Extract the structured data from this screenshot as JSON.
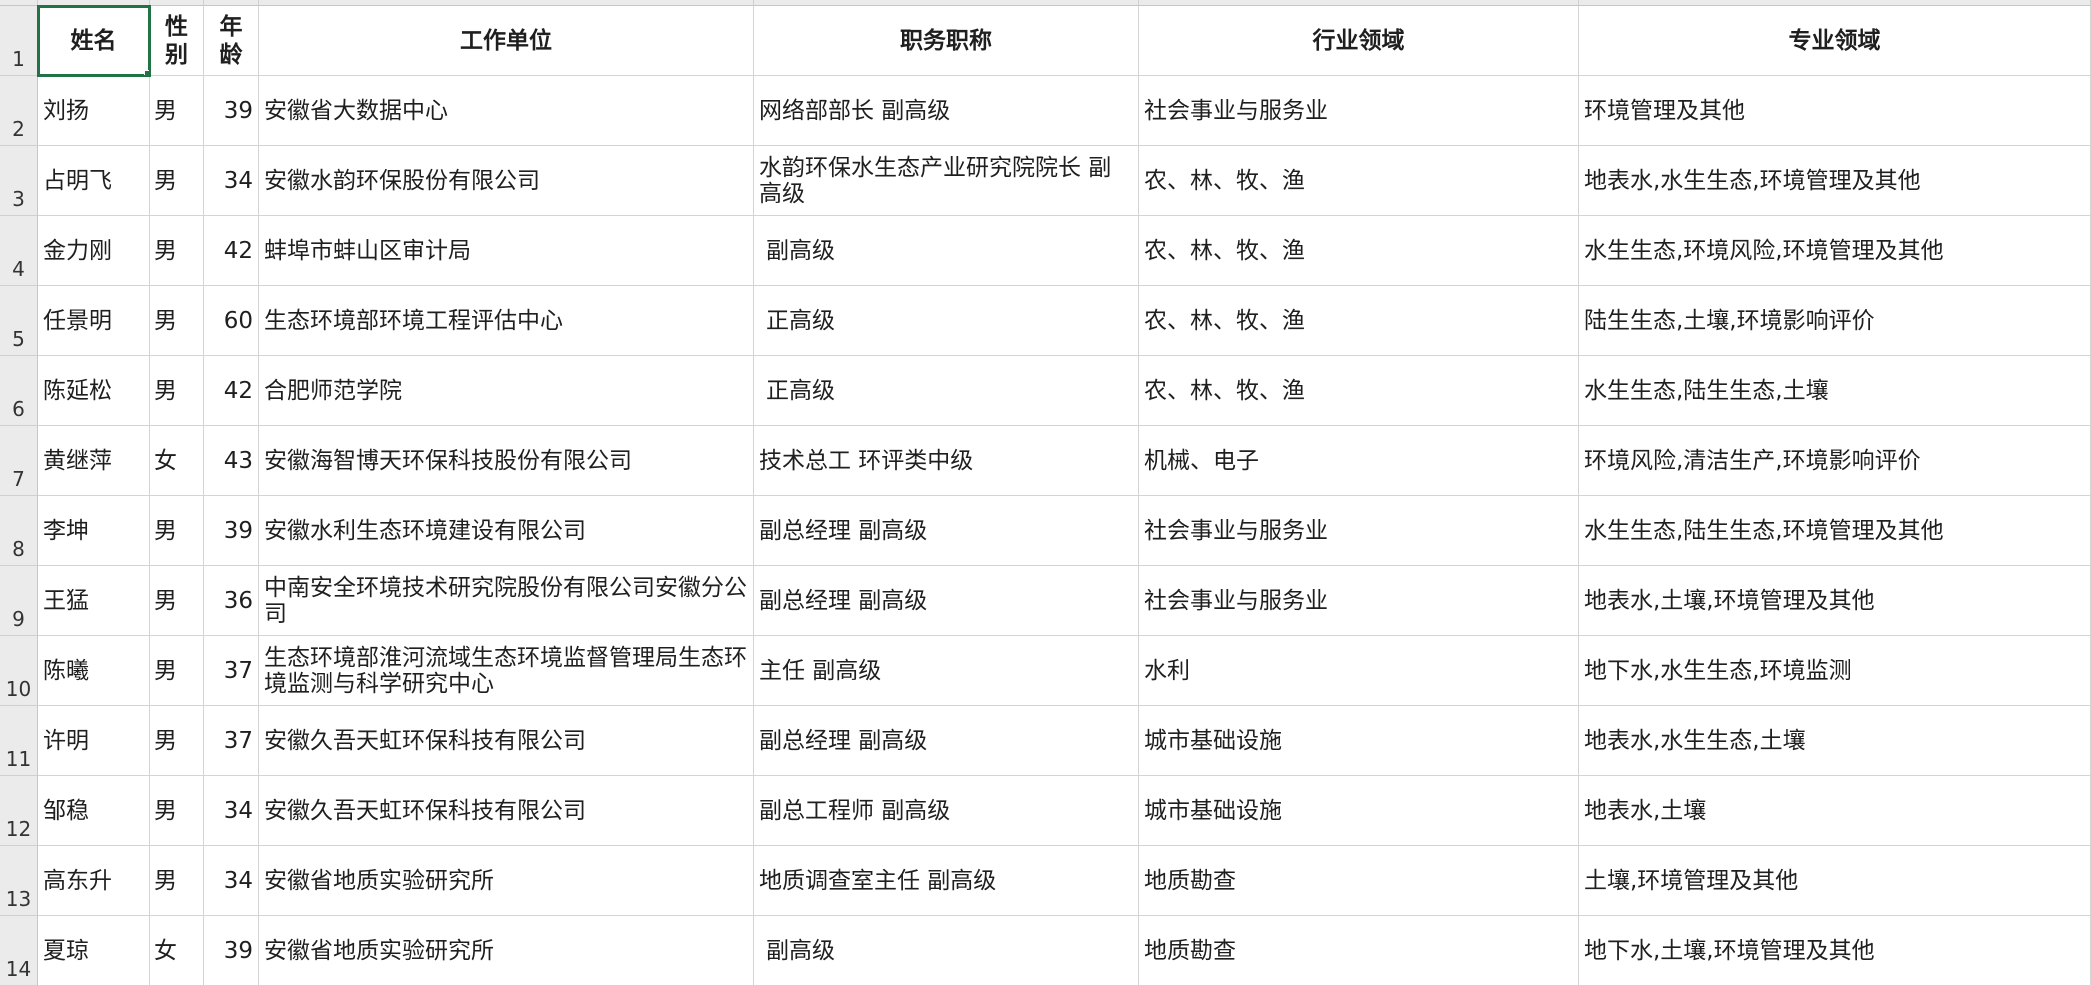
{
  "headers": [
    "姓名",
    "性别",
    "年龄",
    "工作单位",
    "职务职称",
    "行业领域",
    "专业领域"
  ],
  "row_numbers": [
    "1",
    "2",
    "3",
    "4",
    "5",
    "6",
    "7",
    "8",
    "9",
    "10",
    "11",
    "12",
    "13",
    "14"
  ],
  "rows": [
    [
      "刘扬",
      "男",
      "39",
      "安徽省大数据中心",
      "网络部部长 副高级",
      "社会事业与服务业",
      "环境管理及其他"
    ],
    [
      "占明飞",
      "男",
      "34",
      "安徽水韵环保股份有限公司",
      "水韵环保水生态产业研究院院长 副高级",
      "农、林、牧、渔",
      "地表水,水生生态,环境管理及其他"
    ],
    [
      "金力刚",
      "男",
      "42",
      "蚌埠市蚌山区审计局",
      " 副高级",
      "农、林、牧、渔",
      "水生生态,环境风险,环境管理及其他"
    ],
    [
      "任景明",
      "男",
      "60",
      "生态环境部环境工程评估中心",
      " 正高级",
      "农、林、牧、渔",
      "陆生生态,土壤,环境影响评价"
    ],
    [
      "陈延松",
      "男",
      "42",
      "合肥师范学院",
      " 正高级",
      "农、林、牧、渔",
      "水生生态,陆生生态,土壤"
    ],
    [
      "黄继萍",
      "女",
      "43",
      "安徽海智博天环保科技股份有限公司",
      "技术总工 环评类中级",
      "机械、电子",
      "环境风险,清洁生产,环境影响评价"
    ],
    [
      "李坤",
      "男",
      "39",
      "安徽水利生态环境建设有限公司",
      "副总经理 副高级",
      "社会事业与服务业",
      "水生生态,陆生生态,环境管理及其他"
    ],
    [
      "王猛",
      "男",
      "36",
      "中南安全环境技术研究院股份有限公司安徽分公司",
      "副总经理 副高级",
      "社会事业与服务业",
      "地表水,土壤,环境管理及其他"
    ],
    [
      "陈曦",
      "男",
      "37",
      "生态环境部淮河流域生态环境监督管理局生态环境监测与科学研究中心",
      "主任 副高级",
      "水利",
      "地下水,水生生态,环境监测"
    ],
    [
      "许明",
      "男",
      "37",
      "安徽久吾天虹环保科技有限公司",
      "副总经理 副高级",
      "城市基础设施",
      "地表水,水生生态,土壤"
    ],
    [
      "邹稳",
      "男",
      "34",
      "安徽久吾天虹环保科技有限公司",
      "副总工程师 副高级",
      "城市基础设施",
      "地表水,土壤"
    ],
    [
      "高东升",
      "男",
      "34",
      "安徽省地质实验研究所",
      "地质调查室主任 副高级",
      "地质勘查",
      "土壤,环境管理及其他"
    ],
    [
      "夏琼",
      "女",
      "39",
      "安徽省地质实验研究所",
      " 副高级",
      "地质勘查",
      "地下水,土壤,环境管理及其他"
    ]
  ]
}
